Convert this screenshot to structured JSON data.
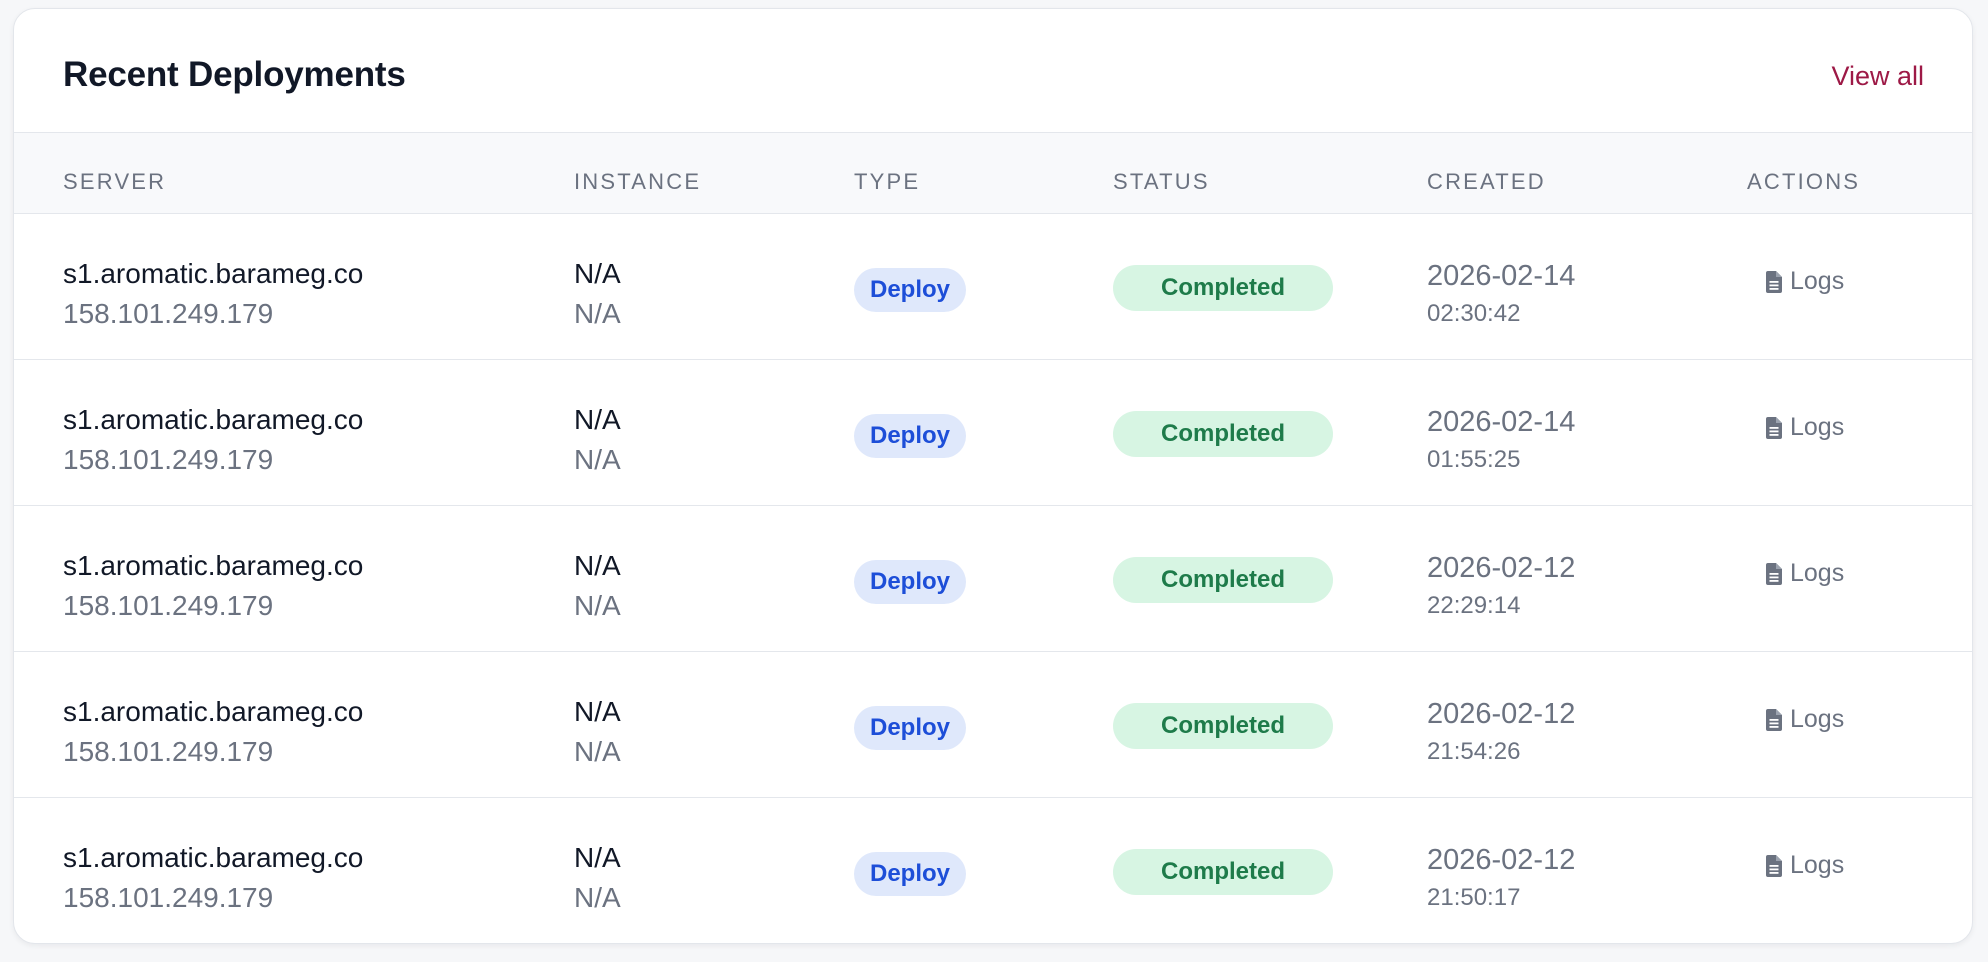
{
  "card": {
    "title": "Recent Deployments",
    "view_all_label": "View all"
  },
  "table": {
    "headers": {
      "server": "SERVER",
      "instance": "INSTANCE",
      "type": "TYPE",
      "status": "STATUS",
      "created": "CREATED",
      "actions": "ACTIONS"
    },
    "rows": [
      {
        "server_name": "s1.aromatic.barameg.co",
        "server_ip": "158.101.249.179",
        "instance_name": "N/A",
        "instance_id": "N/A",
        "type": "Deploy",
        "status": "Completed",
        "created_date": "2026-02-14",
        "created_time": "02:30:42",
        "action_label": "Logs",
        "action_icon": "document-icon"
      },
      {
        "server_name": "s1.aromatic.barameg.co",
        "server_ip": "158.101.249.179",
        "instance_name": "N/A",
        "instance_id": "N/A",
        "type": "Deploy",
        "status": "Completed",
        "created_date": "2026-02-14",
        "created_time": "01:55:25",
        "action_label": "Logs",
        "action_icon": "document-icon"
      },
      {
        "server_name": "s1.aromatic.barameg.co",
        "server_ip": "158.101.249.179",
        "instance_name": "N/A",
        "instance_id": "N/A",
        "type": "Deploy",
        "status": "Completed",
        "created_date": "2026-02-12",
        "created_time": "22:29:14",
        "action_label": "Logs",
        "action_icon": "document-icon"
      },
      {
        "server_name": "s1.aromatic.barameg.co",
        "server_ip": "158.101.249.179",
        "instance_name": "N/A",
        "instance_id": "N/A",
        "type": "Deploy",
        "status": "Completed",
        "created_date": "2026-02-12",
        "created_time": "21:54:26",
        "action_label": "Logs",
        "action_icon": "document-icon"
      },
      {
        "server_name": "s1.aromatic.barameg.co",
        "server_ip": "158.101.249.179",
        "instance_name": "N/A",
        "instance_id": "N/A",
        "type": "Deploy",
        "status": "Completed",
        "created_date": "2026-02-12",
        "created_time": "21:50:17",
        "action_label": "Logs",
        "action_icon": "document-icon"
      }
    ]
  },
  "colors": {
    "link_accent": "#9d1946",
    "type_badge_bg": "#dfe8fb",
    "type_badge_text": "#1d4ed8",
    "status_completed_bg": "#d7f5e3",
    "status_completed_text": "#1e7b4a"
  }
}
